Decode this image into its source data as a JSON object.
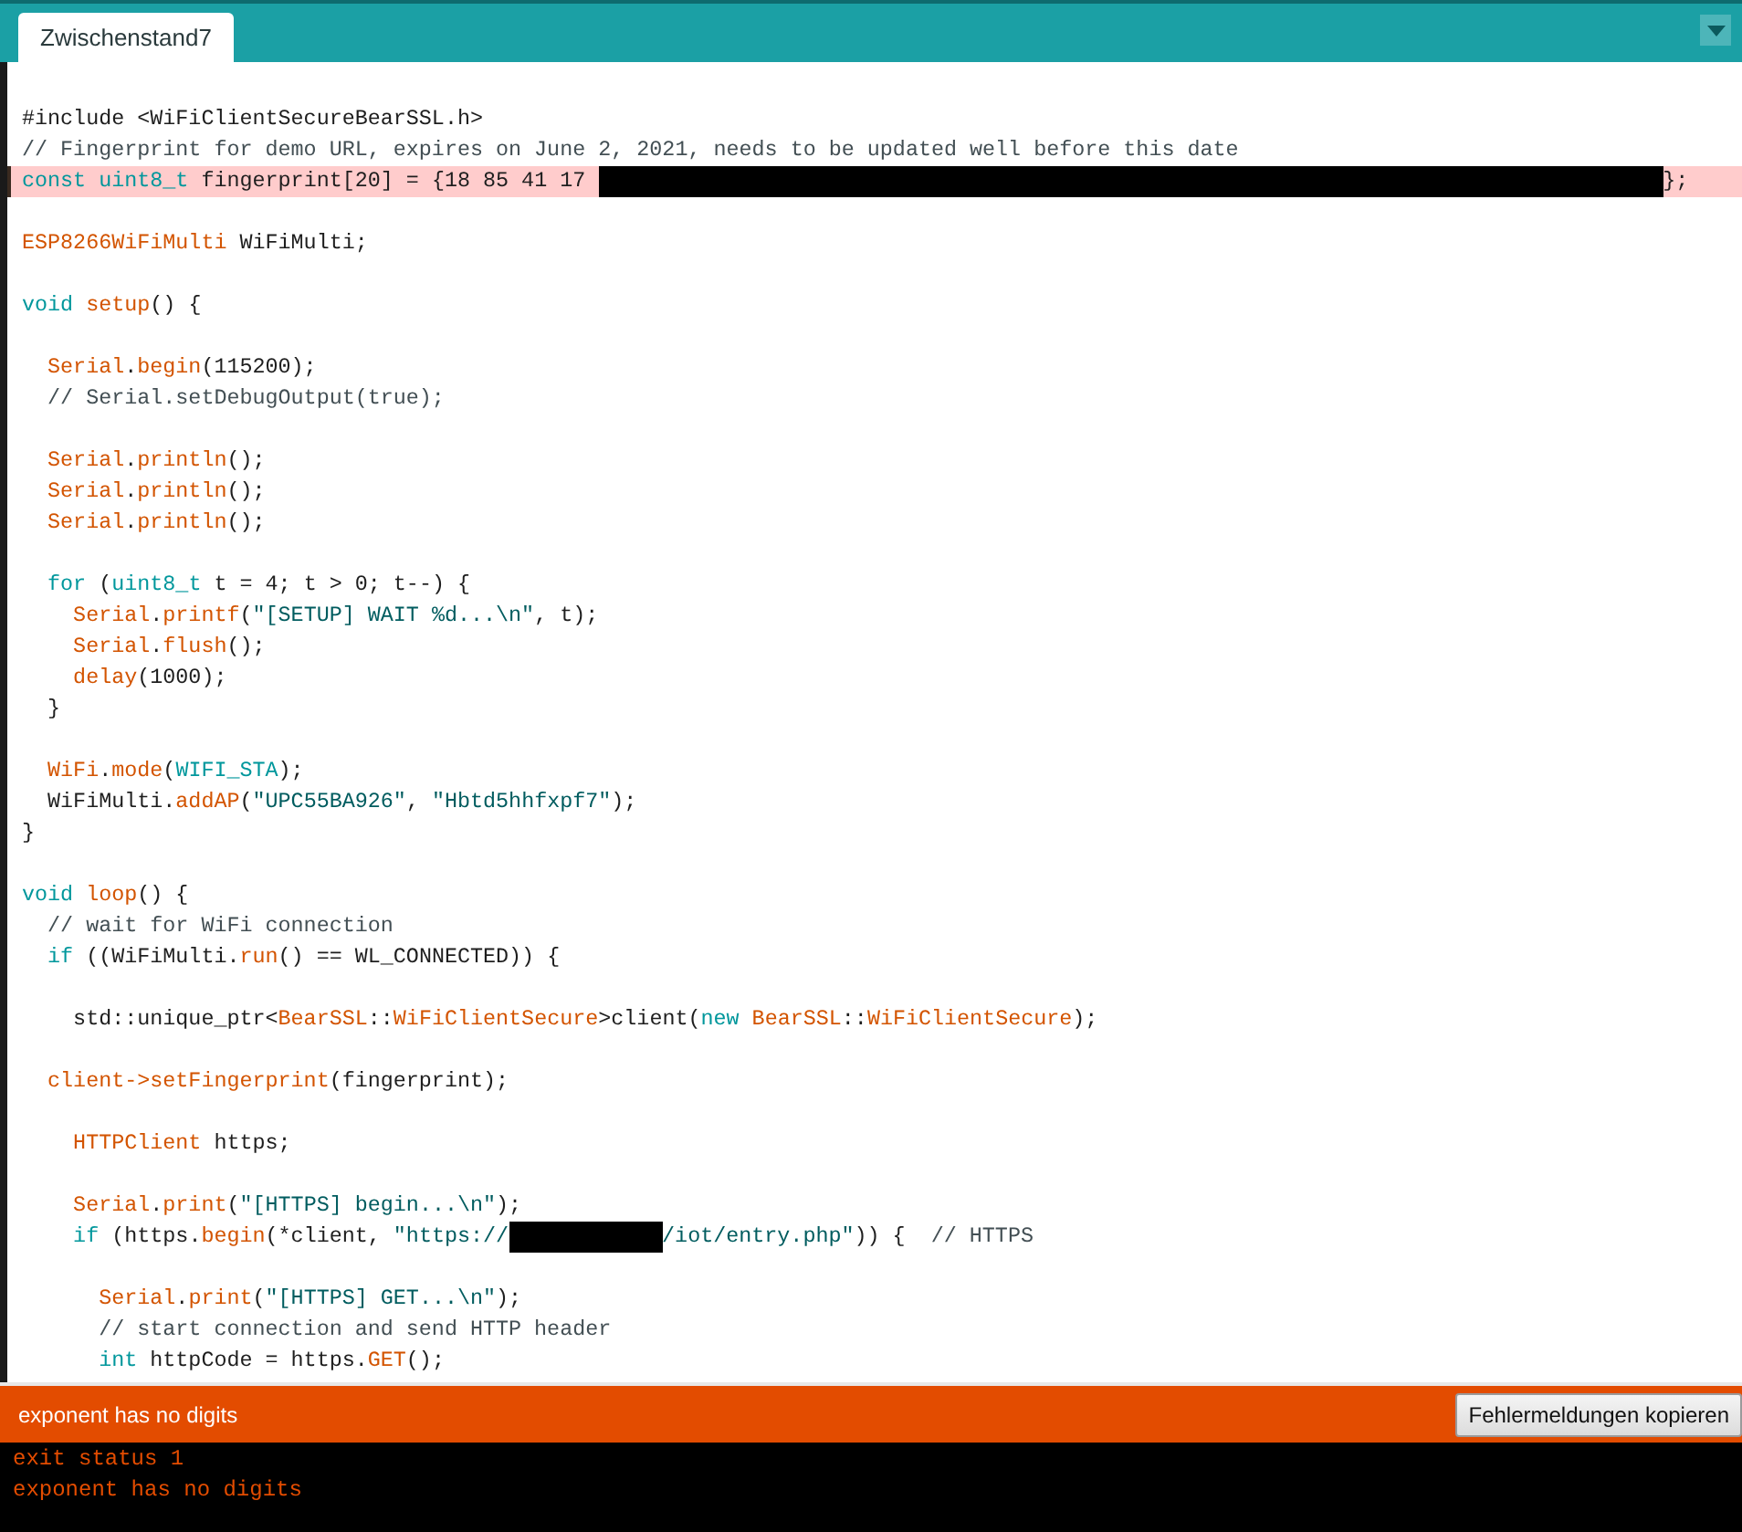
{
  "tab": {
    "label": "Zwischenstand7",
    "selected": true
  },
  "editor": {
    "lines": [
      {
        "error": false,
        "tokens": [
          {
            "kind": "plain",
            "text": "#include <WiFiClientSecureBearSSL.h>"
          }
        ]
      },
      {
        "error": false,
        "tokens": [
          {
            "kind": "comment",
            "text": "// Fingerprint for demo URL, expires on June 2, 2021, needs to be updated well before this date"
          }
        ]
      },
      {
        "error": true,
        "tokens": [
          {
            "kind": "keyword",
            "text": "const "
          },
          {
            "kind": "keyword",
            "text": "uint8_t"
          },
          {
            "kind": "plain",
            "text": " fingerprint[20] = {18 85 41 17 "
          },
          {
            "kind": "redaction_long"
          },
          {
            "kind": "plain",
            "text": "};"
          }
        ]
      },
      {
        "error": false
      },
      {
        "error": false,
        "tokens": [
          {
            "kind": "func",
            "text": "ESP8266WiFiMulti"
          },
          {
            "kind": "plain",
            "text": " WiFiMulti;"
          }
        ]
      },
      {
        "error": false
      },
      {
        "error": false,
        "tokens": [
          {
            "kind": "keyword",
            "text": "void"
          },
          {
            "kind": "func",
            "text": " setup"
          },
          {
            "kind": "plain",
            "text": "() {"
          }
        ]
      },
      {
        "error": false
      },
      {
        "error": false,
        "tokens": [
          {
            "kind": "func",
            "text": "  Serial"
          },
          {
            "kind": "plain",
            "text": "."
          },
          {
            "kind": "func",
            "text": "begin"
          },
          {
            "kind": "plain",
            "text": "(115200);"
          }
        ]
      },
      {
        "error": false,
        "tokens": [
          {
            "kind": "comment",
            "text": "  // Serial.setDebugOutput(true);"
          }
        ]
      },
      {
        "error": false
      },
      {
        "error": false,
        "tokens": [
          {
            "kind": "func",
            "text": "  Serial"
          },
          {
            "kind": "plain",
            "text": "."
          },
          {
            "kind": "func",
            "text": "println"
          },
          {
            "kind": "plain",
            "text": "();"
          }
        ]
      },
      {
        "error": false,
        "tokens": [
          {
            "kind": "func",
            "text": "  Serial"
          },
          {
            "kind": "plain",
            "text": "."
          },
          {
            "kind": "func",
            "text": "println"
          },
          {
            "kind": "plain",
            "text": "();"
          }
        ]
      },
      {
        "error": false,
        "tokens": [
          {
            "kind": "func",
            "text": "  Serial"
          },
          {
            "kind": "plain",
            "text": "."
          },
          {
            "kind": "func",
            "text": "println"
          },
          {
            "kind": "plain",
            "text": "();"
          }
        ]
      },
      {
        "error": false
      },
      {
        "error": false,
        "tokens": [
          {
            "kind": "keyword",
            "text": "  for"
          },
          {
            "kind": "plain",
            "text": " ("
          },
          {
            "kind": "keyword",
            "text": "uint8_t"
          },
          {
            "kind": "plain",
            "text": " t = 4; t > 0; t--) {"
          }
        ]
      },
      {
        "error": false,
        "tokens": [
          {
            "kind": "func",
            "text": "    Serial"
          },
          {
            "kind": "plain",
            "text": "."
          },
          {
            "kind": "func",
            "text": "printf"
          },
          {
            "kind": "plain",
            "text": "("
          },
          {
            "kind": "string",
            "text": "\"[SETUP] WAIT %d...\\n\""
          },
          {
            "kind": "plain",
            "text": ", t);"
          }
        ]
      },
      {
        "error": false,
        "tokens": [
          {
            "kind": "func",
            "text": "    Serial"
          },
          {
            "kind": "plain",
            "text": "."
          },
          {
            "kind": "func",
            "text": "flush"
          },
          {
            "kind": "plain",
            "text": "();"
          }
        ]
      },
      {
        "error": false,
        "tokens": [
          {
            "kind": "func",
            "text": "    delay"
          },
          {
            "kind": "plain",
            "text": "(1000);"
          }
        ]
      },
      {
        "error": false,
        "tokens": [
          {
            "kind": "plain",
            "text": "  }"
          }
        ]
      },
      {
        "error": false
      },
      {
        "error": false,
        "tokens": [
          {
            "kind": "func",
            "text": "  WiFi"
          },
          {
            "kind": "plain",
            "text": "."
          },
          {
            "kind": "func",
            "text": "mode"
          },
          {
            "kind": "plain",
            "text": "("
          },
          {
            "kind": "keyword",
            "text": "WIFI_STA"
          },
          {
            "kind": "plain",
            "text": ");"
          }
        ]
      },
      {
        "error": false,
        "tokens": [
          {
            "kind": "plain",
            "text": "  WiFiMulti."
          },
          {
            "kind": "func",
            "text": "addAP"
          },
          {
            "kind": "plain",
            "text": "("
          },
          {
            "kind": "string",
            "text": "\"UPC55BA926\""
          },
          {
            "kind": "plain",
            "text": ", "
          },
          {
            "kind": "string",
            "text": "\"Hbtd5hhfxpf7\""
          },
          {
            "kind": "plain",
            "text": ");"
          }
        ]
      },
      {
        "error": false,
        "tokens": [
          {
            "kind": "plain",
            "text": "}"
          }
        ]
      },
      {
        "error": false
      },
      {
        "error": false,
        "tokens": [
          {
            "kind": "keyword",
            "text": "void"
          },
          {
            "kind": "func",
            "text": " loop"
          },
          {
            "kind": "plain",
            "text": "() {"
          }
        ]
      },
      {
        "error": false,
        "tokens": [
          {
            "kind": "comment",
            "text": "  // wait for WiFi connection"
          }
        ]
      },
      {
        "error": false,
        "tokens": [
          {
            "kind": "keyword",
            "text": "  if"
          },
          {
            "kind": "plain",
            "text": " ((WiFiMulti."
          },
          {
            "kind": "func",
            "text": "run"
          },
          {
            "kind": "plain",
            "text": "() == WL_CONNECTED)) {"
          }
        ]
      },
      {
        "error": false
      },
      {
        "error": false,
        "tokens": [
          {
            "kind": "plain",
            "text": "    std::unique_ptr<"
          },
          {
            "kind": "func",
            "text": "BearSSL"
          },
          {
            "kind": "plain",
            "text": "::"
          },
          {
            "kind": "func",
            "text": "WiFiClientSecure"
          },
          {
            "kind": "plain",
            "text": ">client("
          },
          {
            "kind": "keyword",
            "text": "new"
          },
          {
            "kind": "func",
            "text": " BearSSL"
          },
          {
            "kind": "plain",
            "text": "::"
          },
          {
            "kind": "func",
            "text": "WiFiClientSecure"
          },
          {
            "kind": "plain",
            "text": ");"
          }
        ]
      },
      {
        "error": false
      },
      {
        "error": false,
        "tokens": [
          {
            "kind": "func",
            "text": "  client->setFingerprint"
          },
          {
            "kind": "plain",
            "text": "(fingerprint);"
          }
        ]
      },
      {
        "error": false
      },
      {
        "error": false,
        "tokens": [
          {
            "kind": "func",
            "text": "    HTTPClient"
          },
          {
            "kind": "plain",
            "text": " https;"
          }
        ]
      },
      {
        "error": false
      },
      {
        "error": false,
        "tokens": [
          {
            "kind": "func",
            "text": "    Serial"
          },
          {
            "kind": "plain",
            "text": "."
          },
          {
            "kind": "func",
            "text": "print"
          },
          {
            "kind": "plain",
            "text": "("
          },
          {
            "kind": "string",
            "text": "\"[HTTPS] begin...\\n\""
          },
          {
            "kind": "plain",
            "text": ");"
          }
        ]
      },
      {
        "error": false,
        "tokens": [
          {
            "kind": "keyword",
            "text": "    if"
          },
          {
            "kind": "plain",
            "text": " (https."
          },
          {
            "kind": "func",
            "text": "begin"
          },
          {
            "kind": "plain",
            "text": "(*client, "
          },
          {
            "kind": "string",
            "text": "\"https://"
          },
          {
            "kind": "redaction_short"
          },
          {
            "kind": "string",
            "text": "/iot/entry.php\""
          },
          {
            "kind": "plain",
            "text": ")) {  "
          },
          {
            "kind": "comment",
            "text": "// HTTPS"
          }
        ]
      },
      {
        "error": false
      },
      {
        "error": false,
        "tokens": [
          {
            "kind": "func",
            "text": "      Serial"
          },
          {
            "kind": "plain",
            "text": "."
          },
          {
            "kind": "func",
            "text": "print"
          },
          {
            "kind": "plain",
            "text": "("
          },
          {
            "kind": "string",
            "text": "\"[HTTPS] GET...\\n\""
          },
          {
            "kind": "plain",
            "text": ");"
          }
        ]
      },
      {
        "error": false,
        "tokens": [
          {
            "kind": "comment",
            "text": "      // start connection and send HTTP header"
          }
        ]
      },
      {
        "error": false,
        "tokens": [
          {
            "kind": "keyword",
            "text": "      int"
          },
          {
            "kind": "plain",
            "text": " httpCode = https."
          },
          {
            "kind": "func",
            "text": "GET"
          },
          {
            "kind": "plain",
            "text": "();"
          }
        ]
      }
    ]
  },
  "status_bar": {
    "message": "exponent has no digits",
    "button": "Fehlermeldungen kopieren"
  },
  "console": {
    "lines": [
      "exit status 1",
      "exponent has no digits"
    ]
  }
}
